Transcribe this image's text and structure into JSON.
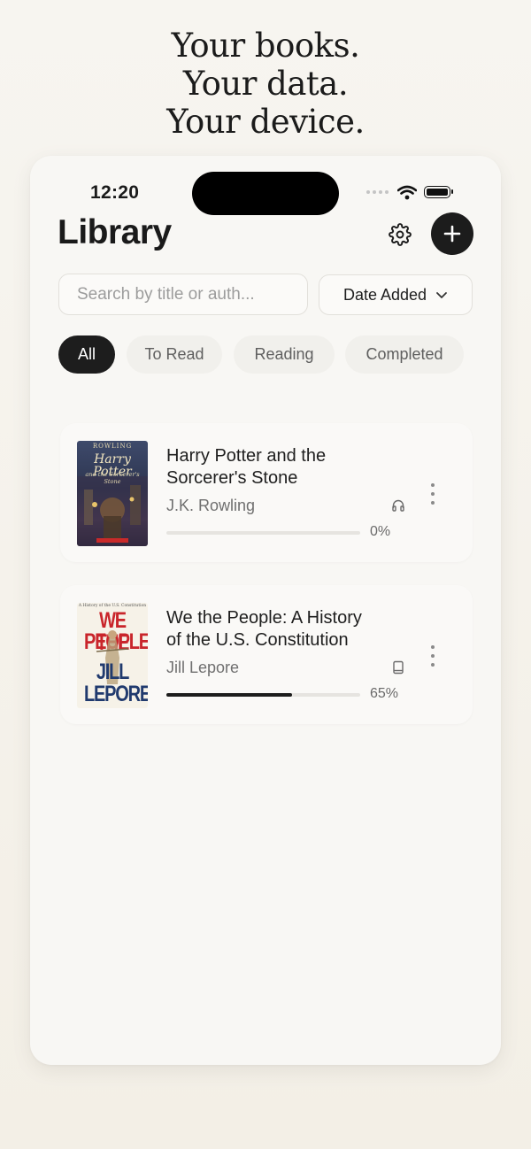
{
  "headline": [
    "Your books.",
    "Your data.",
    "Your device."
  ],
  "status_bar": {
    "time": "12:20"
  },
  "header": {
    "title": "Library",
    "settings_icon": "gear-icon",
    "add_icon": "plus-icon"
  },
  "search": {
    "placeholder": "Search by title or auth..."
  },
  "sort": {
    "label": "Date Added"
  },
  "filters": [
    "All",
    "To Read",
    "Reading",
    "Completed"
  ],
  "books": [
    {
      "title_line1": "Harry Potter and the",
      "title_line2": "Sorcerer's Stone",
      "author": "J.K. Rowling",
      "type_icon": "headphones-icon",
      "progress": 0,
      "progress_label": "0%",
      "cover_text": {
        "top": "ROWLING",
        "main": "Harry Potter",
        "sub": "and the Sorcerer's Stone"
      }
    },
    {
      "title_line1": "We the People: A History",
      "title_line2": "of the U.S. Constitution",
      "author": "Jill Lepore",
      "type_icon": "book-icon",
      "progress": 0.65,
      "progress_label": "65%",
      "cover_text": {
        "top": "A History of the U.S. Constitution",
        "main1": "WE THE",
        "main2": "PEOPLE",
        "author1": "JILL",
        "author2": "LEPORE"
      }
    }
  ],
  "colors": {
    "accent": "#1d1d1d",
    "background": "#f8f7f4",
    "cover_red": "#c9252b",
    "cover_blue": "#203a6e"
  }
}
